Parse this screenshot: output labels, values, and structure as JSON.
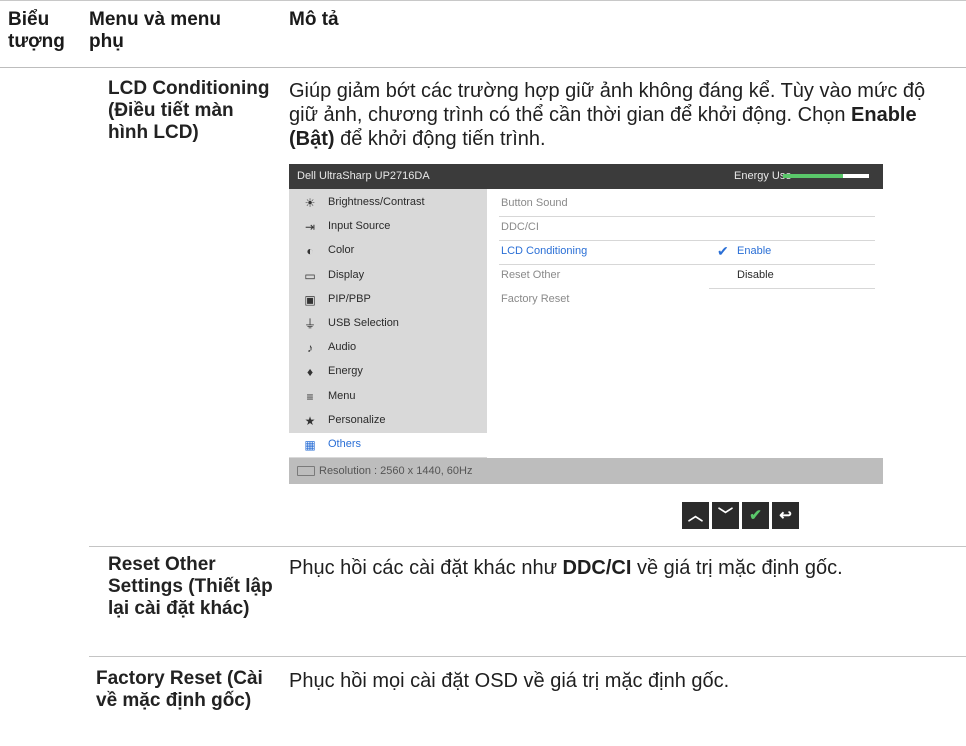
{
  "header": {
    "col_icon": "Biểu tượng",
    "col_menu": "Menu và menu phụ",
    "col_desc": "Mô tả"
  },
  "rows": [
    {
      "title": "LCD Conditioning (Điều tiết màn hình LCD)",
      "desc_pre": "Giúp giảm bớt các trường hợp giữ ảnh không đáng kể. Tùy vào mức độ giữ ảnh, chương trình có thể cần thời gian để khởi động. Chọn ",
      "desc_bold": "Enable (Bật)",
      "desc_post": " để khởi động tiến trình."
    },
    {
      "title": "Reset Other Settings (Thiết lập lại cài đặt khác)",
      "desc_pre": "Phục hồi các cài đặt khác như ",
      "desc_bold": "DDC/CI",
      "desc_post": " về giá trị mặc định gốc."
    },
    {
      "title": "Factory Reset (Cài về mặc định gốc)",
      "desc": "Phục hồi mọi cài đặt OSD về giá trị mặc định gốc."
    }
  ],
  "osd": {
    "title": "Dell UltraSharp UP2716DA",
    "energy_label": "Energy Use",
    "energy_level": 0.7,
    "menu": [
      {
        "label": "Brightness/Contrast",
        "icon": "brightness-icon"
      },
      {
        "label": "Input Source",
        "icon": "input-source-icon"
      },
      {
        "label": "Color",
        "icon": "color-icon"
      },
      {
        "label": "Display",
        "icon": "display-icon"
      },
      {
        "label": "PIP/PBP",
        "icon": "pip-icon"
      },
      {
        "label": "USB Selection",
        "icon": "usb-icon"
      },
      {
        "label": "Audio",
        "icon": "audio-icon"
      },
      {
        "label": "Energy",
        "icon": "energy-icon"
      },
      {
        "label": "Menu",
        "icon": "menu-icon"
      },
      {
        "label": "Personalize",
        "icon": "star-icon"
      },
      {
        "label": "Others",
        "icon": "others-icon",
        "selected": true
      }
    ],
    "submenu": [
      "Button Sound",
      "DDC/CI",
      "LCD Conditioning",
      "Reset Other",
      "Factory Reset"
    ],
    "options": [
      {
        "label": "Enable",
        "checked": true
      },
      {
        "label": "Disable",
        "checked": false
      }
    ],
    "resolution": "Resolution : 2560 x 1440, 60Hz",
    "accent": "#2a6fd6"
  },
  "nav_buttons": [
    {
      "name": "up-button",
      "icon": "chevron-up-icon",
      "glyph": "⌃"
    },
    {
      "name": "down-button",
      "icon": "chevron-down-icon",
      "glyph": "⌄"
    },
    {
      "name": "ok-button",
      "icon": "check-icon",
      "glyph": "✔"
    },
    {
      "name": "back-button",
      "icon": "back-icon",
      "glyph": "↩"
    }
  ]
}
